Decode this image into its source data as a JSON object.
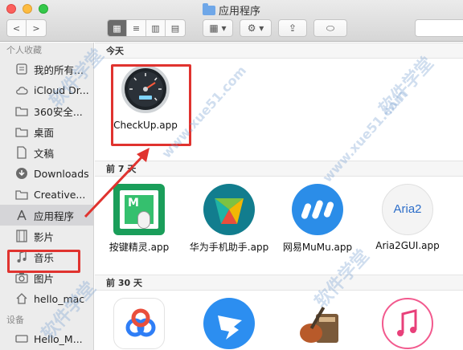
{
  "window": {
    "title": "应用程序"
  },
  "toolbar": {
    "back": "<",
    "forward": ">",
    "view_icon": "▦",
    "view_list": "≡",
    "view_columns": "▥",
    "view_cover": "▤",
    "group": "▦ ▾",
    "action": "⚙ ▾",
    "share": "⇪",
    "tags": "⬭"
  },
  "sidebar": {
    "favorites_title": "个人收藏",
    "items": [
      {
        "label": "我的所有...",
        "icon": "all-files-icon"
      },
      {
        "label": "iCloud Dr...",
        "icon": "cloud-icon"
      },
      {
        "label": "360安全...",
        "icon": "folder-icon"
      },
      {
        "label": "桌面",
        "icon": "folder-icon"
      },
      {
        "label": "文稿",
        "icon": "document-icon"
      },
      {
        "label": "Downloads",
        "icon": "download-icon"
      },
      {
        "label": "Creative...",
        "icon": "folder-icon"
      },
      {
        "label": "应用程序",
        "icon": "applications-icon"
      },
      {
        "label": "影片",
        "icon": "film-icon"
      },
      {
        "label": "音乐",
        "icon": "music-icon"
      },
      {
        "label": "图片",
        "icon": "camera-icon"
      },
      {
        "label": "hello_mac",
        "icon": "home-icon"
      }
    ],
    "devices_title": "设备",
    "devices": [
      {
        "label": "Hello_M...",
        "icon": "disk-icon"
      }
    ]
  },
  "groups": {
    "today": "今天",
    "prev7": "前 7 天",
    "prev30": "前 30 天"
  },
  "apps": {
    "today": [
      {
        "name": "CheckUp.app"
      }
    ],
    "prev7": [
      {
        "name": "按键精灵.app"
      },
      {
        "name": "华为手机助手.app"
      },
      {
        "name": "网易MuMu.app"
      },
      {
        "name": "Aria2GUI.app"
      }
    ],
    "aria2_icon_text": "Aria2",
    "keyspirit_icon_text": "M"
  },
  "watermarks": [
    "软件学堂",
    "www.xue51.com",
    "软件学堂",
    "www.xue51.com",
    "软件学堂",
    "软件学堂"
  ],
  "colors": {
    "highlight": "#e0332f",
    "sidebar_bg": "#ececec"
  }
}
